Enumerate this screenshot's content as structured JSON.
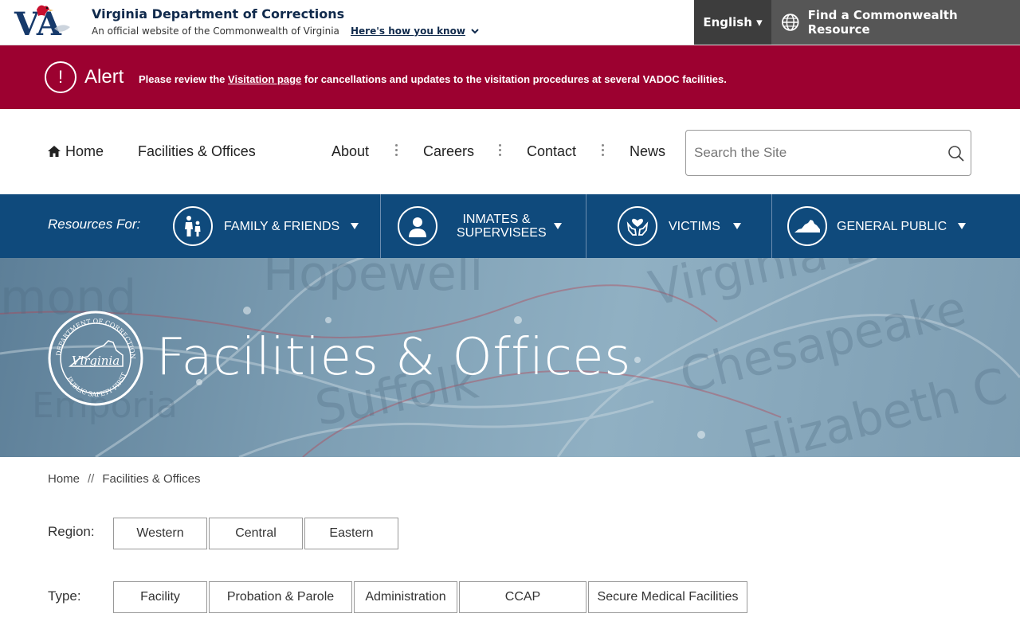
{
  "header": {
    "site_title": "Virginia Department of Corrections",
    "official_text": "An official website of the Commonwealth of Virginia",
    "how_you_know": "Here's how you know",
    "language": "English ▾",
    "find_resource": "Find a Commonwealth Resource",
    "logo_letters": "VA"
  },
  "alert": {
    "title": "Alert",
    "icon": "!",
    "text_before": "Please review the ",
    "link": "Visitation page",
    "text_after": " for cancellations and updates to the visitation procedures at several VADOC facilities."
  },
  "nav": {
    "home": "Home",
    "facilities": "Facilities & Offices",
    "about": "About",
    "careers": "Careers",
    "contact": "Contact",
    "news": "News",
    "search_placeholder": "Search the Site"
  },
  "resources": {
    "label": "Resources For:",
    "items": [
      {
        "label": "Family & Friends",
        "icon": "family-icon"
      },
      {
        "label": "Inmates & Supervisees",
        "icon": "person-icon"
      },
      {
        "label": "Victims",
        "icon": "heart-hands-icon"
      },
      {
        "label": "General Public",
        "icon": "virginia-map-icon"
      }
    ]
  },
  "hero": {
    "title": "Facilities & Offices",
    "seal_top": "DEPARTMENT OF CORRECTIONS",
    "seal_bottom": "PUBLIC SAFETY FIRST",
    "seal_center": "Virginia"
  },
  "breadcrumb": {
    "home": "Home",
    "separator": "//",
    "current": "Facilities & Offices"
  },
  "filters": {
    "region_label": "Region:",
    "regions": [
      "Western",
      "Central",
      "Eastern"
    ],
    "type_label": "Type:",
    "types": [
      "Facility",
      "Probation & Parole",
      "Administration",
      "CCAP",
      "Secure Medical Facilities"
    ]
  },
  "colors": {
    "alert_bg": "#9c0130",
    "resources_bg": "#0f4a7c",
    "title_navy": "#102a4c"
  }
}
